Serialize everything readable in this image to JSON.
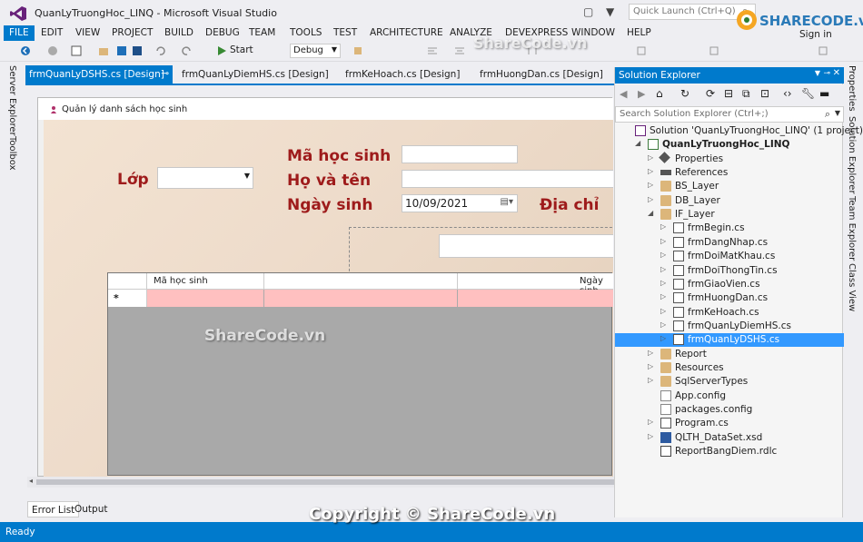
{
  "window": {
    "title": "QuanLyTruongHoc_LINQ - Microsoft Visual Studio",
    "quick_launch_placeholder": "Quick Launch (Ctrl+Q)",
    "sign_in": "Sign in"
  },
  "menu": [
    "FILE",
    "EDIT",
    "VIEW",
    "PROJECT",
    "BUILD",
    "DEBUG",
    "TEAM",
    "TOOLS",
    "TEST",
    "ARCHITECTURE",
    "ANALYZE",
    "DEVEXPRESS",
    "WINDOW",
    "HELP"
  ],
  "toolbar": {
    "start_label": "Start",
    "config": "Debug"
  },
  "left_strip": [
    "Server Explorer",
    "Toolbox"
  ],
  "right_strip": [
    "Properties",
    "Solution Explorer",
    "Team Explorer",
    "Class View"
  ],
  "doc_tabs": [
    "frmQuanLyDSHS.cs [Design]",
    "frmQuanLyDiemHS.cs [Design]",
    "frmKeHoach.cs [Design]",
    "frmHuongDan.cs [Design]"
  ],
  "form": {
    "title": "Quản lý danh sách học sinh",
    "labels": {
      "lop": "Lớp",
      "ma_hs": "Mã học sinh",
      "ho_ten": "Họ và tên",
      "ngay_sinh": "Ngày sinh",
      "dia_chi": "Địa chỉ"
    },
    "date_value": "10/09/2021",
    "grid_headers": [
      "Mã học sinh",
      "Ngày sinh"
    ],
    "new_row_marker": "*"
  },
  "bottom_tabs": [
    "Error List",
    "Output"
  ],
  "status": "Ready",
  "solution_explorer": {
    "title": "Solution Explorer",
    "search_placeholder": "Search Solution Explorer (Ctrl+;)",
    "items": [
      {
        "label": "Solution 'QuanLyTruongHoc_LINQ' (1 project)",
        "icon": "solution-icon",
        "level": 0,
        "arrow": ""
      },
      {
        "label": "QuanLyTruongHoc_LINQ",
        "icon": "csharp-project-icon",
        "level": 1,
        "arrow": "expanded",
        "bold": true
      },
      {
        "label": "Properties",
        "icon": "properties-icon",
        "level": 2,
        "arrow": "collapsed"
      },
      {
        "label": "References",
        "icon": "references-icon",
        "level": 2,
        "arrow": "collapsed"
      },
      {
        "label": "BS_Layer",
        "icon": "folder-icon",
        "level": 2,
        "arrow": "collapsed"
      },
      {
        "label": "DB_Layer",
        "icon": "folder-icon",
        "level": 2,
        "arrow": "collapsed"
      },
      {
        "label": "IF_Layer",
        "icon": "folder-open-icon",
        "level": 2,
        "arrow": "expanded"
      },
      {
        "label": "frmBegin.cs",
        "icon": "form-file-icon",
        "level": 3,
        "arrow": "collapsed"
      },
      {
        "label": "frmDangNhap.cs",
        "icon": "form-file-icon",
        "level": 3,
        "arrow": "collapsed"
      },
      {
        "label": "frmDoiMatKhau.cs",
        "icon": "form-file-icon",
        "level": 3,
        "arrow": "collapsed"
      },
      {
        "label": "frmDoiThongTin.cs",
        "icon": "form-file-icon",
        "level": 3,
        "arrow": "collapsed"
      },
      {
        "label": "frmGiaoVien.cs",
        "icon": "form-file-icon",
        "level": 3,
        "arrow": "collapsed"
      },
      {
        "label": "frmHuongDan.cs",
        "icon": "form-file-icon",
        "level": 3,
        "arrow": "collapsed"
      },
      {
        "label": "frmKeHoach.cs",
        "icon": "form-file-icon",
        "level": 3,
        "arrow": "collapsed"
      },
      {
        "label": "frmQuanLyDiemHS.cs",
        "icon": "form-file-icon",
        "level": 3,
        "arrow": "collapsed"
      },
      {
        "label": "frmQuanLyDSHS.cs",
        "icon": "form-file-icon",
        "level": 3,
        "arrow": "collapsed",
        "selected": true
      },
      {
        "label": "Report",
        "icon": "folder-icon",
        "level": 2,
        "arrow": "collapsed"
      },
      {
        "label": "Resources",
        "icon": "folder-icon",
        "level": 2,
        "arrow": "collapsed"
      },
      {
        "label": "SqlServerTypes",
        "icon": "folder-icon",
        "level": 2,
        "arrow": "collapsed"
      },
      {
        "label": "App.config",
        "icon": "config-icon",
        "level": 2,
        "arrow": ""
      },
      {
        "label": "packages.config",
        "icon": "config-icon",
        "level": 2,
        "arrow": ""
      },
      {
        "label": "Program.cs",
        "icon": "csharp-file-icon",
        "level": 2,
        "arrow": "collapsed"
      },
      {
        "label": "QLTH_DataSet.xsd",
        "icon": "dataset-icon",
        "level": 2,
        "arrow": "collapsed"
      },
      {
        "label": "ReportBangDiem.rdlc",
        "icon": "report-icon",
        "level": 2,
        "arrow": ""
      }
    ]
  },
  "watermarks": {
    "logo_text": "SHARECODE.vn",
    "center": "ShareCode.vn",
    "left": "ShareCode.vn",
    "copyright": "Copyright © ShareCode.vn"
  },
  "colors": {
    "accent": "#007acc",
    "label_red": "#9e1b1b",
    "grid_new_row": "#ffc0c0",
    "selected": "#3399ff"
  }
}
